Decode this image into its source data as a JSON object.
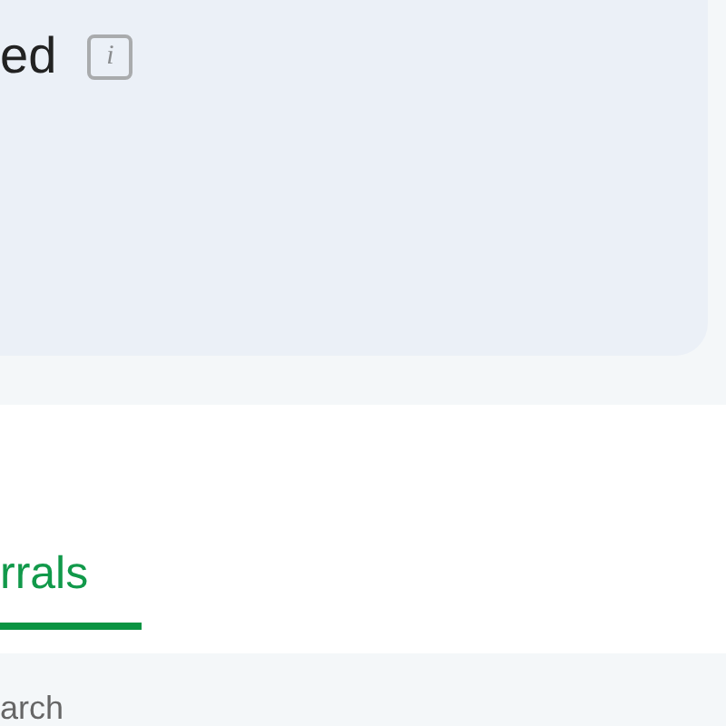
{
  "card": {
    "title": "ed",
    "info_icon": "i"
  },
  "tabs": [
    {
      "label": "rrals",
      "selected": true
    }
  ],
  "search": {
    "placeholder": "arch"
  }
}
